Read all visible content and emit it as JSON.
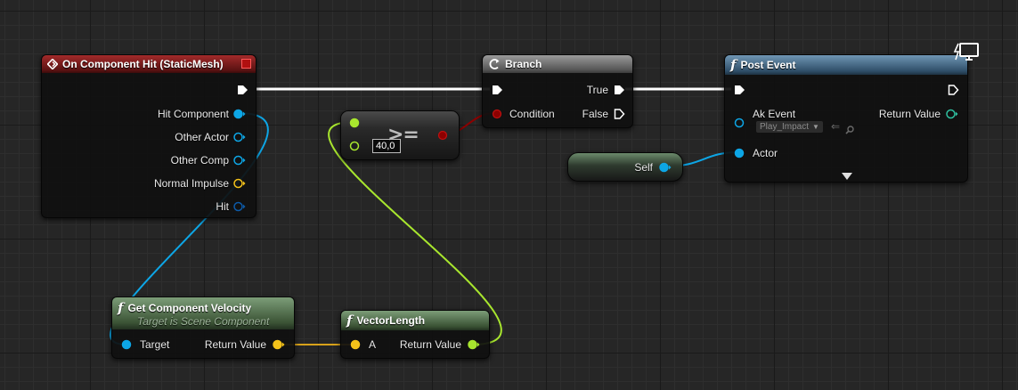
{
  "nodes": {
    "event": {
      "title": "On Component Hit (StaticMesh)",
      "pins": [
        "Hit Component",
        "Other Actor",
        "Other Comp",
        "Normal Impulse",
        "Hit"
      ]
    },
    "branch": {
      "title": "Branch",
      "condition_label": "Condition",
      "true_label": "True",
      "false_label": "False"
    },
    "compare": {
      "operator": ">=",
      "value": "40,0"
    },
    "post_event": {
      "title": "Post Event",
      "ak_event_label": "Ak Event",
      "ak_event_value": "Play_Impact",
      "return_label": "Return Value",
      "actor_label": "Actor"
    },
    "self": {
      "label": "Self"
    },
    "get_velocity": {
      "title": "Get Component Velocity",
      "subtitle": "Target is Scene Component",
      "target_label": "Target",
      "return_label": "Return Value"
    },
    "vector_length": {
      "title": "VectorLength",
      "input_label": "A",
      "return_label": "Return Value"
    }
  },
  "colors": {
    "exec": "#ffffff",
    "object": "#0da6e6",
    "bool": "#8c0000",
    "float": "#a8e62e",
    "vector": "#f4c21a",
    "struct": "#0d5aa8"
  }
}
